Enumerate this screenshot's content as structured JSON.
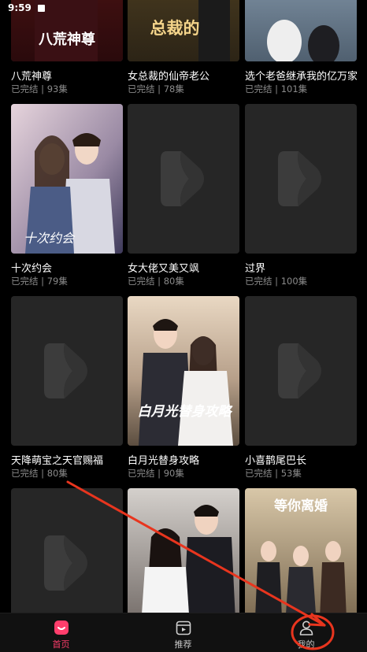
{
  "status_bar": {
    "time": "9:59"
  },
  "dramas": [
    {
      "title": "八荒神尊",
      "status": "已完结",
      "episodes": "93集",
      "poster_text": "八荒神尊",
      "poster": "image"
    },
    {
      "title": "女总裁的仙帝老公",
      "status": "已完结",
      "episodes": "78集",
      "poster_text": "总裁的",
      "poster": "image"
    },
    {
      "title": "选个老爸继承我的亿万家...",
      "status": "已完结",
      "episodes": "101集",
      "poster": "image"
    },
    {
      "title": "十次约会",
      "status": "已完结",
      "episodes": "79集",
      "poster_text": "十次约会",
      "poster": "image"
    },
    {
      "title": "女大佬又美又飒",
      "status": "已完结",
      "episodes": "80集",
      "poster": "placeholder"
    },
    {
      "title": "过界",
      "status": "已完结",
      "episodes": "100集",
      "poster": "placeholder"
    },
    {
      "title": "天降萌宝之天官赐福",
      "status": "已完结",
      "episodes": "80集",
      "poster": "placeholder"
    },
    {
      "title": "白月光替身攻略",
      "status": "已完结",
      "episodes": "90集",
      "poster_text": "白月光替身攻略",
      "poster": "image"
    },
    {
      "title": "小喜鹊尾巴长",
      "status": "已完结",
      "episodes": "53集",
      "poster": "placeholder"
    },
    {
      "title": "",
      "status": "",
      "episodes": "",
      "poster": "placeholder"
    },
    {
      "title": "",
      "status": "",
      "episodes": "",
      "poster": "image"
    },
    {
      "title": "",
      "status": "",
      "episodes": "",
      "poster_text": "等你离婚",
      "poster": "image"
    }
  ],
  "tabbar": {
    "home_label": "首页",
    "recommend_label": "推荐",
    "mine_label": "我的"
  },
  "colors": {
    "accent": "#ff3e6c",
    "annotation": "#e8351e",
    "placeholder_bg": "#262626",
    "placeholder_logo": "#3c3c3c"
  },
  "icons": {
    "home": "home-icon",
    "recommend": "play-card-icon",
    "mine": "user-icon",
    "placeholder": "play-logo-icon"
  }
}
